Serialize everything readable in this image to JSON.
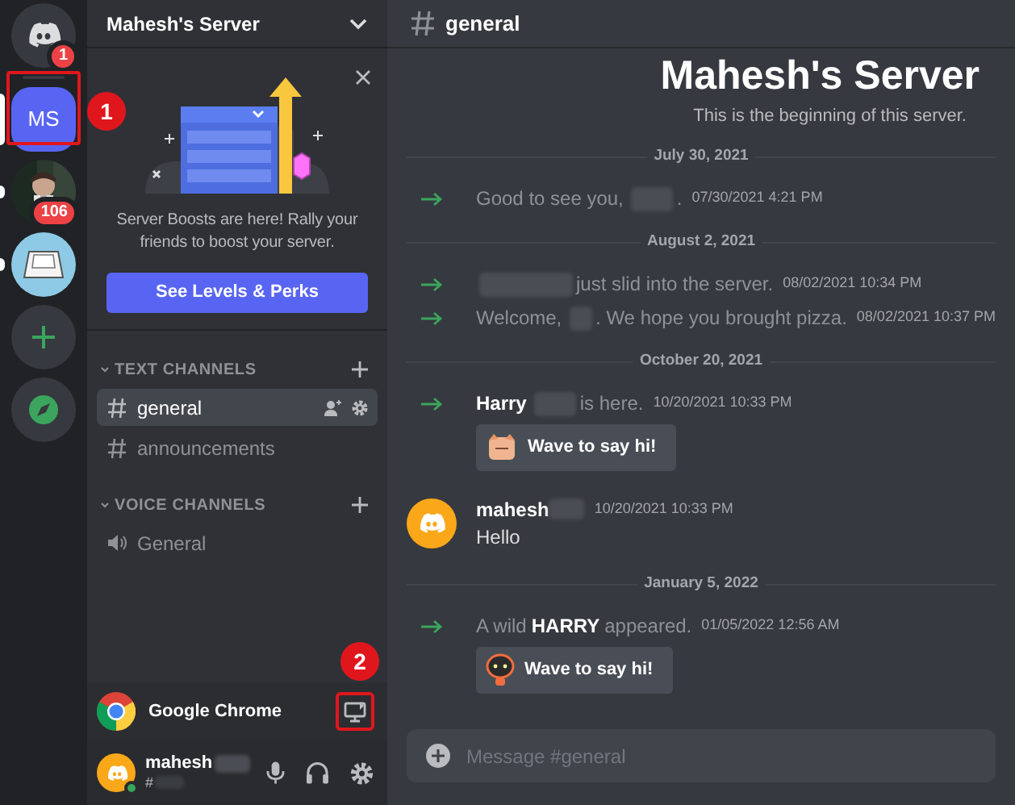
{
  "servers": [
    {
      "kind": "home",
      "selected": false,
      "unread": false,
      "badge": "1"
    },
    {
      "kind": "initials",
      "label": "MS",
      "selected": true,
      "unread": false
    },
    {
      "kind": "picture",
      "selected": false,
      "unread": true,
      "badge": "106"
    },
    {
      "kind": "keycap",
      "selected": false,
      "unread": true
    },
    {
      "kind": "add",
      "selected": false,
      "unread": false
    },
    {
      "kind": "explore",
      "selected": false,
      "unread": false
    }
  ],
  "sidebar": {
    "server_name": "Mahesh's Server",
    "boost_card": {
      "text": "Server Boosts are here! Rally your friends to boost your server.",
      "button": "See Levels & Perks"
    },
    "categories": [
      {
        "name": "TEXT CHANNELS",
        "expanded": true,
        "channels": [
          {
            "kind": "text",
            "name": "general",
            "selected": true
          },
          {
            "kind": "text",
            "name": "announcements",
            "selected": false
          }
        ]
      },
      {
        "name": "VOICE CHANNELS",
        "expanded": true,
        "channels": [
          {
            "kind": "voice",
            "name": "General",
            "selected": false
          }
        ]
      }
    ],
    "activity": {
      "app": "Google Chrome"
    },
    "user": {
      "name": "mahesh",
      "tag": "#"
    }
  },
  "chat": {
    "channel": "general",
    "welcome_title": "Mahesh's Server",
    "welcome_subtitle": "This is the beginning of this server.",
    "items": [
      {
        "kind": "divider",
        "date": "July 30, 2021"
      },
      {
        "kind": "join",
        "segments": [
          {
            "kind": "text",
            "text": "Good to see you,"
          },
          {
            "kind": "redacted"
          },
          {
            "kind": "text",
            "text": "."
          }
        ],
        "timestamp": "07/30/2021 4:21 PM"
      },
      {
        "kind": "divider",
        "date": "August 2, 2021"
      },
      {
        "kind": "join",
        "segments": [
          {
            "kind": "redacted"
          },
          {
            "kind": "text",
            "text": "just slid into the server."
          }
        ],
        "timestamp": "08/02/2021 10:34 PM"
      },
      {
        "kind": "join",
        "segments": [
          {
            "kind": "text",
            "text": "Welcome,"
          },
          {
            "kind": "redacted"
          },
          {
            "kind": "text",
            "text": ". We hope you brought pizza."
          }
        ],
        "timestamp": "08/02/2021 10:37 PM"
      },
      {
        "kind": "divider",
        "date": "October 20, 2021"
      },
      {
        "kind": "join",
        "segments": [
          {
            "kind": "name",
            "text": "Harry"
          },
          {
            "kind": "redacted"
          },
          {
            "kind": "text",
            "text": "is here."
          }
        ],
        "timestamp": "10/20/2021 10:33 PM",
        "wave": "Wave to say hi!"
      },
      {
        "kind": "message",
        "author": "mahesh",
        "timestamp": "10/20/2021 10:33 PM",
        "text": "Hello"
      },
      {
        "kind": "divider",
        "date": "January 5, 2022"
      },
      {
        "kind": "join",
        "segments": [
          {
            "kind": "text",
            "text": "A wild"
          },
          {
            "kind": "name",
            "text": "HARRY"
          },
          {
            "kind": "text",
            "text": "appeared."
          }
        ],
        "timestamp": "01/05/2022 12:56 AM",
        "wave": "Wave to say hi!"
      }
    ],
    "input_placeholder": "Message #general"
  },
  "annotations": [
    {
      "label": "1"
    },
    {
      "label": "2"
    }
  ]
}
